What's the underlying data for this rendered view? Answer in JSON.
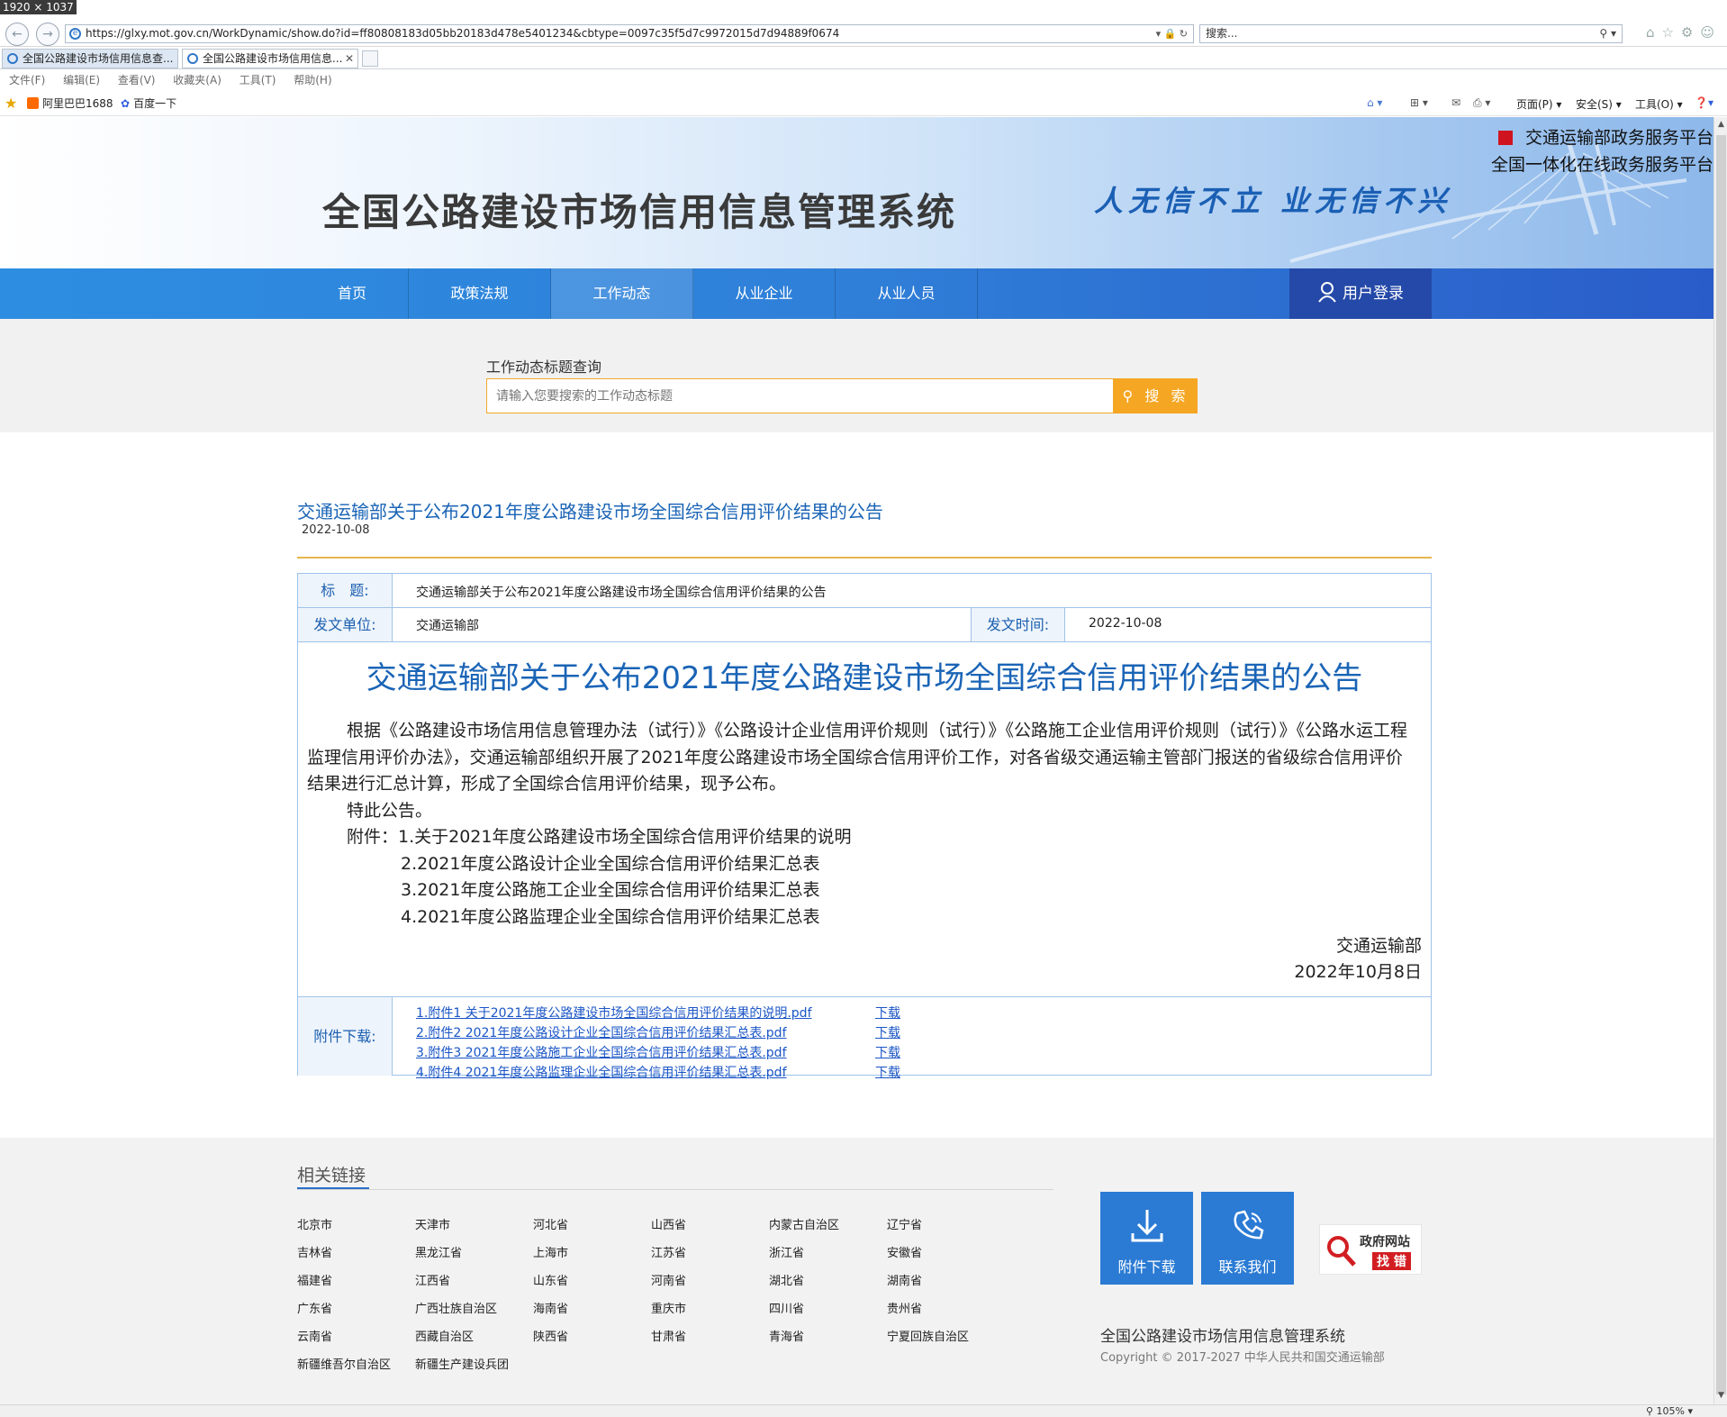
{
  "screenshot_label": "1920 × 1037",
  "browser": {
    "url": "https://glxy.mot.gov.cn/WorkDynamic/show.do?id=ff80808183d05bb20183d478e5401234&cbtype=0097c35f5d7c9972015d7d94889f0674",
    "search_placeholder": "搜索...",
    "tabs": [
      {
        "label": "全国公路建设市场信用信息查..."
      },
      {
        "label": "全国公路建设市场信用信息..."
      }
    ],
    "menu": [
      "文件(F)",
      "编辑(E)",
      "查看(V)",
      "收藏夹(A)",
      "工具(T)",
      "帮助(H)"
    ],
    "favorites": [
      "阿里巴巴1688",
      "百度一下"
    ],
    "commands": [
      "页面(P)",
      "安全(S)",
      "工具(O)"
    ],
    "zoom": "105%"
  },
  "header": {
    "title": "全国公路建设市场信用信息管理系统",
    "slogan": "人无信不立 业无信不兴",
    "platform1": "交通运输部政务服务平台",
    "platform2": "全国一体化在线政务服务平台"
  },
  "nav": {
    "items": [
      "首页",
      "政策法规",
      "工作动态",
      "从业企业",
      "从业人员"
    ],
    "active": "工作动态",
    "login": "用户登录"
  },
  "search": {
    "label": "工作动态标题查询",
    "placeholder": "请输入您要搜索的工作动态标题",
    "button": "搜 索"
  },
  "article": {
    "title": "交通运输部关于公布2021年度公路建设市场全国综合信用评价结果的公告",
    "date": "2022-10-08",
    "fields": {
      "title_label": "标　题:",
      "title_value": "交通运输部关于公布2021年度公路建设市场全国综合信用评价结果的公告",
      "unit_label": "发文单位:",
      "unit_value": "交通运输部",
      "time_label": "发文时间:",
      "time_value": "2022-10-08"
    },
    "heading": "交通运输部关于公布2021年度公路建设市场全国综合信用评价结果的公告",
    "body": "根据《公路建设市场信用信息管理办法（试行）》《公路设计企业信用评价规则（试行）》《公路施工企业信用评价规则（试行）》《公路水运工程监理信用评价办法》，交通运输部组织开展了2021年度公路建设市场全国综合信用评价工作，对各省级交通运输主管部门报送的省级综合信用评价结果进行汇总计算，形成了全国综合信用评价结果，现予公布。",
    "notice": "特此公告。",
    "attachments_intro": "附件：1.关于2021年度公路建设市场全国综合信用评价结果的说明",
    "attachments": [
      "2.2021年度公路设计企业全国综合信用评价结果汇总表",
      "3.2021年度公路施工企业全国综合信用评价结果汇总表",
      "4.2021年度公路监理企业全国综合信用评价结果汇总表"
    ],
    "signer": "交通运输部",
    "sign_date": "2022年10月8日",
    "download_label": "附件下载:",
    "files": [
      "1.附件1 关于2021年度公路建设市场全国综合信用评价结果的说明.pdf",
      "2.附件2 2021年度公路设计企业全国综合信用评价结果汇总表.pdf",
      "3.附件3 2021年度公路施工企业全国综合信用评价结果汇总表.pdf",
      "4.附件4 2021年度公路监理企业全国综合信用评价结果汇总表.pdf"
    ],
    "download_text": "下载"
  },
  "footer": {
    "related_title": "相关链接",
    "links": [
      [
        "北京市",
        "天津市",
        "河北省",
        "山西省",
        "内蒙古自治区",
        "辽宁省"
      ],
      [
        "吉林省",
        "黑龙江省",
        "上海市",
        "江苏省",
        "浙江省",
        "安徽省"
      ],
      [
        "福建省",
        "江西省",
        "山东省",
        "河南省",
        "湖北省",
        "湖南省"
      ],
      [
        "广东省",
        "广西壮族自治区",
        "海南省",
        "重庆市",
        "四川省",
        "贵州省"
      ],
      [
        "云南省",
        "西藏自治区",
        "陕西省",
        "甘肃省",
        "青海省",
        "宁夏回族自治区"
      ],
      [
        "新疆维吾尔自治区",
        "新疆生产建设兵团"
      ]
    ],
    "box1": "附件下载",
    "box2": "联系我们",
    "find_t1": "政府网站",
    "find_t2": "找 错",
    "site_name": "全国公路建设市场信用信息管理系统",
    "copyright": "Copyright © 2017-2027 中华人民共和国交通运输部"
  }
}
